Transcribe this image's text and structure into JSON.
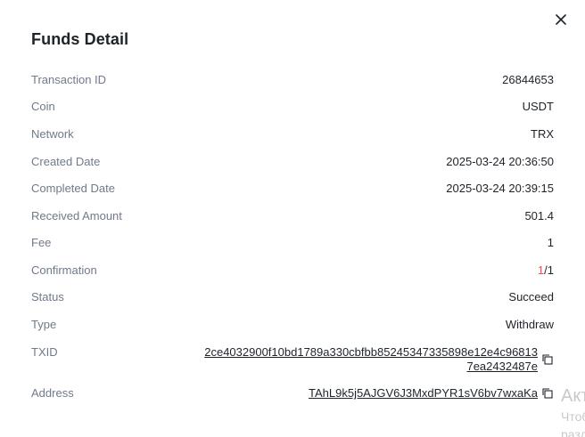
{
  "dialog": {
    "title": "Funds Detail",
    "close_icon": "close-icon"
  },
  "details": {
    "transaction_id": {
      "label": "Transaction ID",
      "value": "26844653"
    },
    "coin": {
      "label": "Coin",
      "value": "USDT"
    },
    "network": {
      "label": "Network",
      "value": "TRX"
    },
    "created_date": {
      "label": "Created Date",
      "value": "2025-03-24 20:36:50"
    },
    "completed_date": {
      "label": "Completed Date",
      "value": "2025-03-24 20:39:15"
    },
    "received_amount": {
      "label": "Received Amount",
      "value": "501.4"
    },
    "fee": {
      "label": "Fee",
      "value": "1"
    },
    "confirmation": {
      "label": "Confirmation",
      "current": "1",
      "separator": "/",
      "total": "1"
    },
    "status": {
      "label": "Status",
      "value": "Succeed"
    },
    "type": {
      "label": "Type",
      "value": "Withdraw"
    },
    "txid": {
      "label": "TXID",
      "value_line1": "2ce4032900f10bd1789a330cbfbb85245347335898e12e4c96813",
      "value_line2": "7ea2432487e",
      "copy_icon": "copy-icon"
    },
    "address": {
      "label": "Address",
      "value": "TAhL9k5j5AJGV6J3MxdPYR1sV6bv7wxaKa",
      "copy_icon": "copy-icon"
    }
  },
  "os_watermark": {
    "title": "Акт",
    "line1": "Чтоб",
    "line2": "разд"
  },
  "colors": {
    "label": "#707a8a",
    "value": "#1e2329",
    "confirmation_current": "#f6465d",
    "background": "#ffffff"
  }
}
